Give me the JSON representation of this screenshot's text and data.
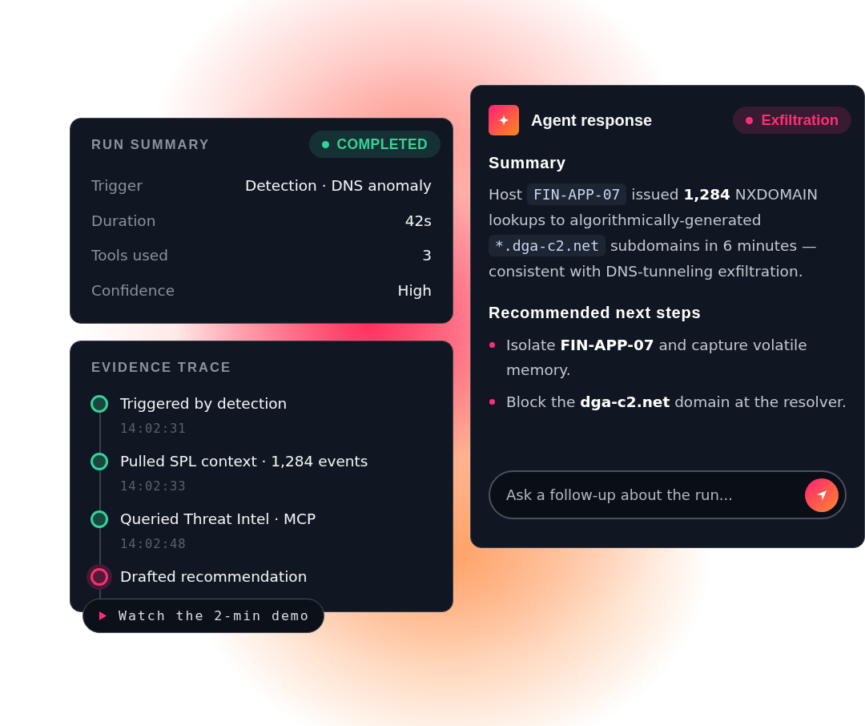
{
  "run_summary": {
    "title": "RUN SUMMARY",
    "status": {
      "label": "COMPLETED",
      "color": "#34d399"
    },
    "rows": [
      {
        "label": "Trigger",
        "value": "Detection · DNS anomaly"
      },
      {
        "label": "Duration",
        "value": "42s"
      },
      {
        "label": "Tools used",
        "value": "3"
      },
      {
        "label": "Confidence",
        "value": "High"
      }
    ]
  },
  "evidence_trace": {
    "title": "EVIDENCE TRACE",
    "steps": [
      {
        "label": "Triggered by detection",
        "time": "14:02:31",
        "color": "#34d399",
        "current": false
      },
      {
        "label": "Pulled SPL context · 1,284 events",
        "time": "14:02:33",
        "color": "#34d399",
        "current": false
      },
      {
        "label": "Queried Threat Intel · MCP",
        "time": "14:02:48",
        "color": "#34d399",
        "current": false
      },
      {
        "label": "Drafted recommendation",
        "color": "#ff2d78",
        "current": true
      }
    ]
  },
  "demo_link": {
    "label": "Watch the 2-min demo"
  },
  "agent_response": {
    "title": "Agent response",
    "tag": {
      "label": "Exfiltration",
      "color": "#ff2d78"
    },
    "summary_heading": "Summary",
    "summary": [
      {
        "kind": "text",
        "text": "Host "
      },
      {
        "kind": "code",
        "text": "FIN-APP-07"
      },
      {
        "kind": "text",
        "text": " issued **1,284** NXDOMAIN lookups to algorithmically-generated "
      },
      {
        "kind": "code",
        "text": "*.dga-c2.net"
      },
      {
        "kind": "text",
        "text": " subdomains in 6 minutes — consistent with DNS-tunneling exfiltration."
      }
    ],
    "steps_heading": "Recommended next steps",
    "steps": [
      "Isolate **FIN-APP-07** and capture volatile memory.",
      "Block the **dga-c2.net** domain at the resolver."
    ],
    "follow_up": {
      "placeholder": "Ask a follow-up about the run..."
    }
  }
}
